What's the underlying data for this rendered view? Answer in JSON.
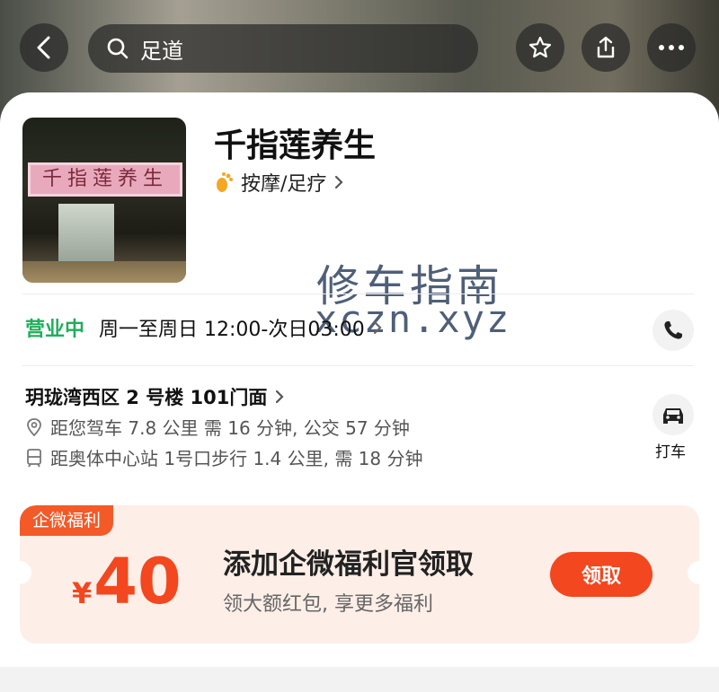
{
  "header": {
    "search_text": "足道"
  },
  "shop": {
    "name": "千指莲养生",
    "sign_text": "千指莲养生",
    "category": "按摩/足疗"
  },
  "watermark": {
    "line1": "修车指南",
    "line2": "xczn.xyz"
  },
  "hours": {
    "status": "营业中",
    "text": "周一至周日 12:00-次日03:00"
  },
  "location": {
    "address": "玥珑湾西区 2 号楼 101门面",
    "drive_info": "距您驾车 7.8 公里 需 16 分钟, 公交 57 分钟",
    "transit_info": "距奥体中心站 1号口步行 1.4 公里, 需 18 分钟",
    "taxi_label": "打车"
  },
  "coupon": {
    "tag": "企微福利",
    "currency": "¥",
    "amount": "40",
    "title": "添加企微福利官领取",
    "subtitle": "领大额红包, 享更多福利",
    "button": "领取"
  },
  "colors": {
    "accent": "#f2471f",
    "open_green": "#1fae5a"
  }
}
